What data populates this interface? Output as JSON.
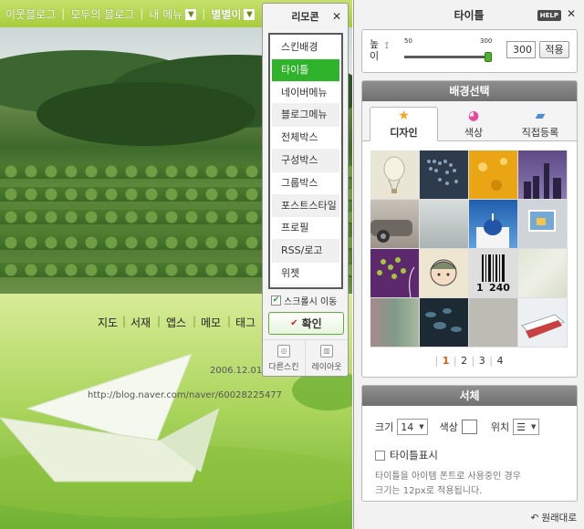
{
  "blog": {
    "topbar": {
      "neighbor_blog": "이웃블로그",
      "all_blog": "모두의 블로그",
      "my_menu": "내 메뉴",
      "user_name": "별별이"
    },
    "menu_links": [
      "지도",
      "서재",
      "앱스",
      "메모",
      "태그"
    ],
    "post_date": "2006.12.01.",
    "post_url": "http://blog.naver.com/naver/60028225477"
  },
  "remote": {
    "title": "리모콘",
    "items": [
      "스킨배경",
      "타이틀",
      "네이버메뉴",
      "블로그메뉴",
      "전체박스",
      "구성박스",
      "그룹박스",
      "포스트스타일",
      "프로필",
      "RSS/로고",
      "위젯"
    ],
    "active_index": 1,
    "scroll_move_label": "스크롤시 이동",
    "scroll_move_checked": true,
    "confirm_label": "확인",
    "other_skin_label": "다른스킨",
    "layout_label": "레이아웃"
  },
  "panel": {
    "title": "타이틀",
    "help_label": "HELP",
    "height": {
      "label": "높이",
      "min": "50",
      "max": "300",
      "value": "300",
      "fraction": 1.0,
      "apply_label": "적용"
    },
    "background": {
      "section_title": "배경선택",
      "tabs": [
        "디자인",
        "색상",
        "직접등록"
      ],
      "active_tab": 0,
      "pages": [
        "1",
        "2",
        "3",
        "4"
      ],
      "current_page": "1",
      "thumb_labels": [
        "1",
        "240"
      ]
    },
    "font": {
      "section_title": "서체",
      "size_label": "크기",
      "size_value": "14",
      "color_label": "색상",
      "align_label": "위치",
      "show_title_label": "타이틀표시",
      "show_title_checked": false,
      "note_line1": "타이틀을 아이템 폰트로 사용중인 경우",
      "note_line2": "크기는 12px로 적용됩니다."
    },
    "restore_label": "원래대로"
  },
  "colors": {
    "accent_green": "#2eb32a",
    "page_current": "#e05a0a",
    "section_header": "#7a7a7a"
  }
}
